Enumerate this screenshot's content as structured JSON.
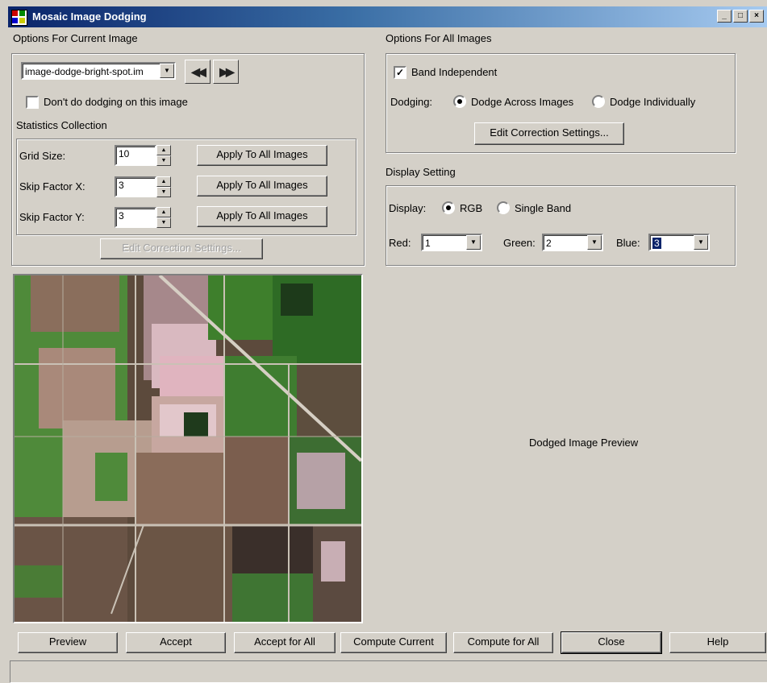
{
  "window": {
    "title": "Mosaic Image Dodging",
    "minimize": "_",
    "maximize": "□",
    "close": "×"
  },
  "current": {
    "section_title": "Options For Current Image",
    "image_select": "image-dodge-bright-spot.im",
    "prev_icon": "◀◀",
    "next_icon": "▶▶",
    "dont_dodge_label": "Don't do dodging on this image",
    "dont_dodge_checked": false,
    "stats_title": "Statistics Collection",
    "grid_label": "Grid Size:",
    "grid_value": "10",
    "skipx_label": "Skip Factor X:",
    "skipx_value": "3",
    "skipy_label": "Skip Factor Y:",
    "skipy_value": "3",
    "apply_all": "Apply To All Images",
    "edit_correction": "Edit Correction Settings..."
  },
  "all": {
    "section_title": "Options For All Images",
    "band_independent_label": "Band Independent",
    "band_independent_checked": true,
    "dodging_label": "Dodging:",
    "dodge_across": "Dodge Across Images",
    "dodge_individually": "Dodge Individually",
    "edit_correction": "Edit Correction Settings..."
  },
  "display": {
    "section_title": "Display Setting",
    "display_label": "Display:",
    "rgb": "RGB",
    "single_band": "Single Band",
    "red_label": "Red:",
    "red_value": "1",
    "green_label": "Green:",
    "green_value": "2",
    "blue_label": "Blue:",
    "blue_value": "3"
  },
  "preview_text": "Dodged Image Preview",
  "buttons": {
    "preview": "Preview",
    "accept": "Accept",
    "accept_all": "Accept for All",
    "compute_current": "Compute Current",
    "compute_all": "Compute for All",
    "close": "Close",
    "help": "Help"
  },
  "colors": {
    "title_start": "#0a246a",
    "title_end": "#a6caf0",
    "face": "#d4d0c8",
    "selection": "#0a246a"
  }
}
